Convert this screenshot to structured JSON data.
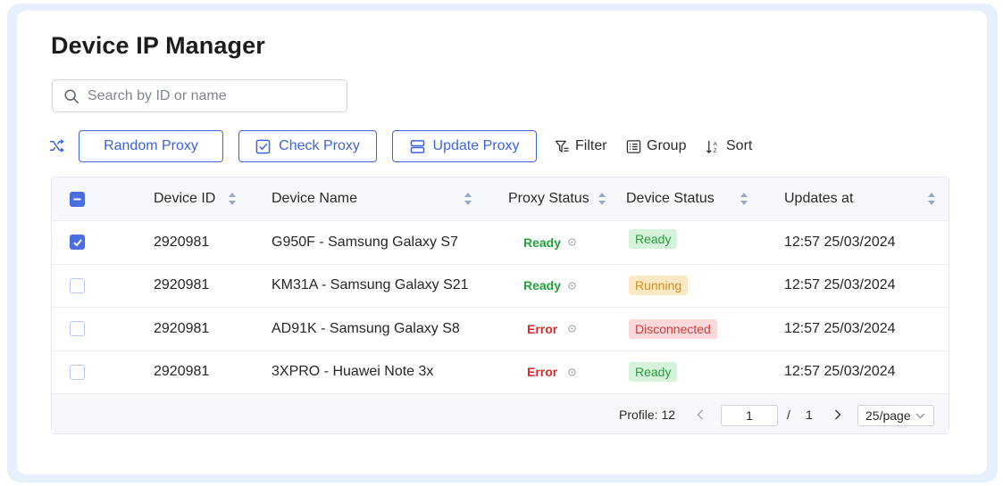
{
  "page": {
    "title": "Device IP Manager"
  },
  "search": {
    "placeholder": "Search by ID or name",
    "value": ""
  },
  "toolbar": {
    "random_proxy": "Random Proxy",
    "check_proxy": "Check Proxy",
    "update_proxy": "Update Proxy",
    "filter": "Filter",
    "group": "Group",
    "sort": "Sort"
  },
  "table": {
    "columns": {
      "device_id": "Device ID",
      "device_name": "Device Name",
      "proxy_status": "Proxy Status",
      "device_status": "Device Status",
      "updates_at": "Updates at"
    },
    "rows": [
      {
        "checked": true,
        "device_id": "2920981",
        "device_name": "G950F - Samsung Galaxy S7",
        "proxy_status": "Ready",
        "device_status": "Ready",
        "updates_at": "12:57 25/03/2024"
      },
      {
        "checked": false,
        "device_id": "2920981",
        "device_name": "KM31A - Samsung Galaxy S21",
        "proxy_status": "Ready",
        "device_status": "Running",
        "updates_at": "12:57 25/03/2024"
      },
      {
        "checked": false,
        "device_id": "2920981",
        "device_name": "AD91K - Samsung Galaxy S8",
        "proxy_status": "Error",
        "device_status": "Disconnected",
        "updates_at": "12:57 25/03/2024"
      },
      {
        "checked": false,
        "device_id": "2920981",
        "device_name": "3XPRO - Huawei Note 3x",
        "proxy_status": "Error",
        "device_status": "Ready",
        "updates_at": "12:57 25/03/2024"
      }
    ]
  },
  "pagination": {
    "profile_label": "Profile: 12",
    "current_page": "1",
    "separator": "/",
    "total_pages": "1",
    "page_size": "25/page"
  },
  "colors": {
    "accent": "#3d63dd",
    "ready": "#1fa33a",
    "error": "#d92b2b",
    "running": "#d1901f"
  },
  "icons": {
    "search": "search-icon",
    "shuffle": "shuffle-icon",
    "check": "checkbox-icon",
    "update": "server-icon",
    "filter": "filter-icon",
    "group": "list-icon",
    "sort": "sort-az-icon",
    "info": "info-icon"
  }
}
